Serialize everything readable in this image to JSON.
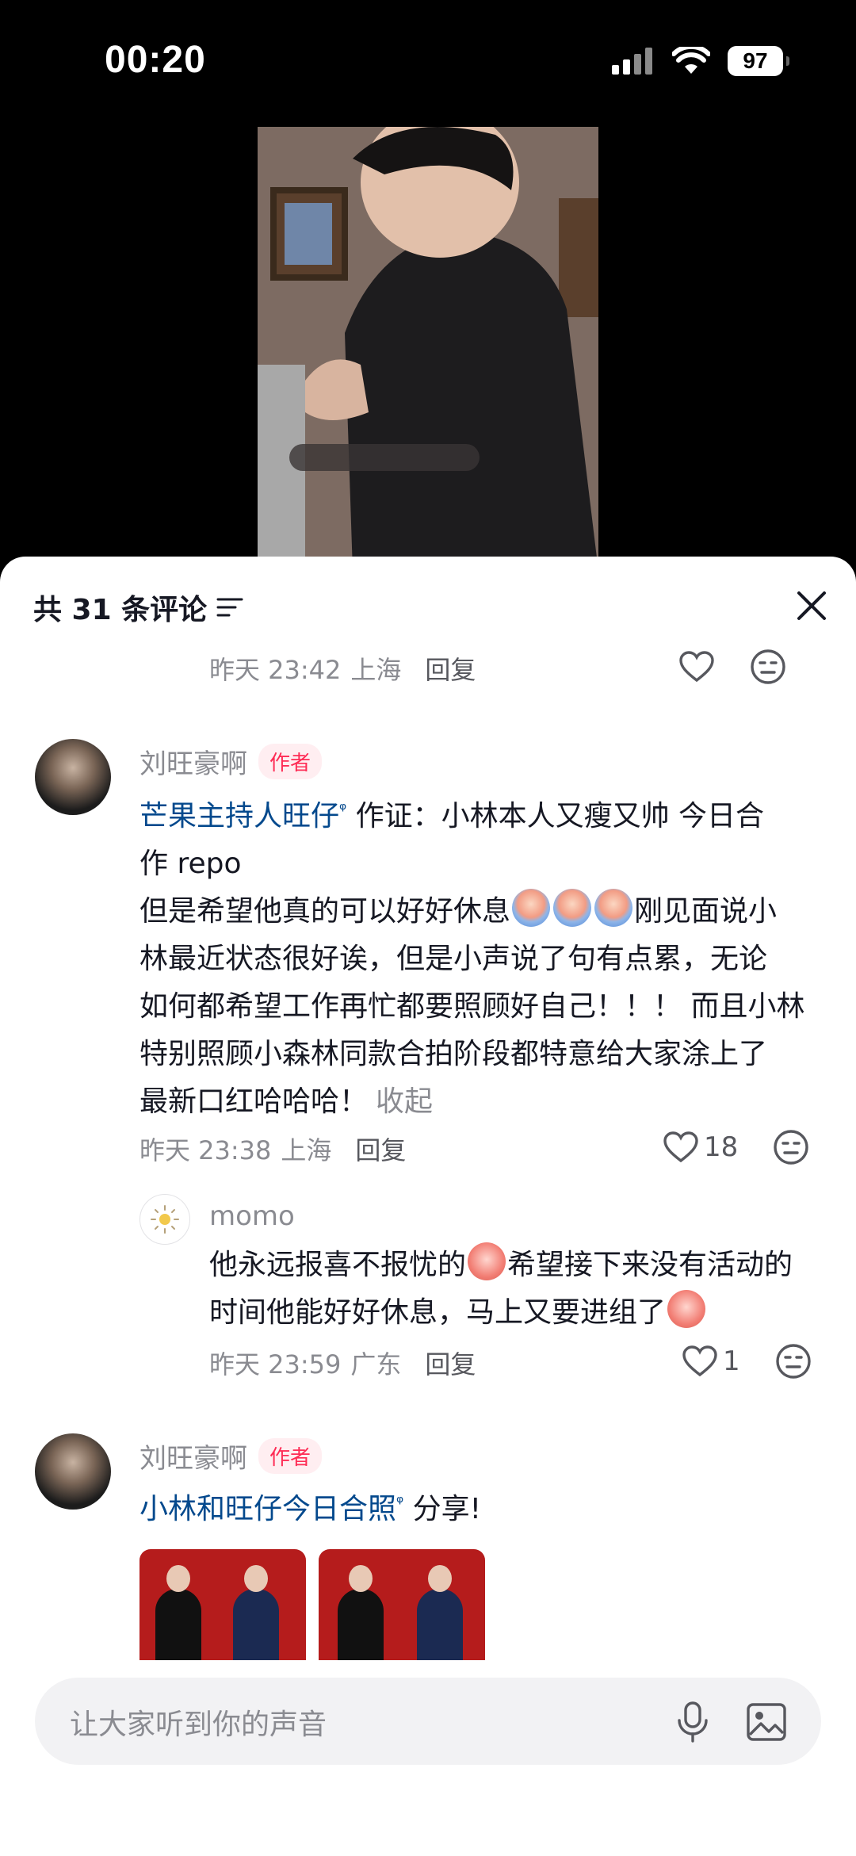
{
  "status_bar": {
    "time": "00:20",
    "battery": "97"
  },
  "header": {
    "title": "共 31 条评论"
  },
  "top_comment_meta": {
    "time": "昨天 23:42",
    "location": "上海",
    "reply": "回复"
  },
  "comment1": {
    "username": "刘旺豪啊",
    "badge": "作者",
    "mention": "芒果主持人旺仔",
    "line1_tail": " 作证：小林本人又瘦又帅 今日合",
    "line2": "作 repo",
    "line3_head": "但是希望他真的可以好好休息",
    "line3_tail": "刚见面说小",
    "line4": "林最近状态很好诶，但是小声说了句有点累，无论",
    "line5": "如何都希望工作再忙都要照顾好自己！！！ 而且小林",
    "line6": "特别照顾小森林同款合拍阶段都特意给大家涂上了",
    "line7": "最新口红哈哈哈！",
    "collapse": "收起",
    "time": "昨天 23:38",
    "location": "上海",
    "reply": "回复",
    "likes": "18"
  },
  "reply1": {
    "username": "momo",
    "line1_head": "他永远报喜不报忧的",
    "line1_tail": "希望接下来没有活动的",
    "line2": "时间他能好好休息，马上又要进组了",
    "time": "昨天 23:59",
    "location": "广东",
    "reply": "回复",
    "likes": "1"
  },
  "comment2": {
    "username": "刘旺豪啊",
    "badge": "作者",
    "mention": "小林和旺仔今日合照",
    "tail": " 分享!"
  },
  "input": {
    "placeholder": "让大家听到你的声音"
  },
  "icons": [
    "signal-icon",
    "wifi-icon",
    "battery-icon",
    "filter-icon",
    "close-icon",
    "heart-icon",
    "dislike-face-icon",
    "microphone-icon",
    "image-icon"
  ]
}
